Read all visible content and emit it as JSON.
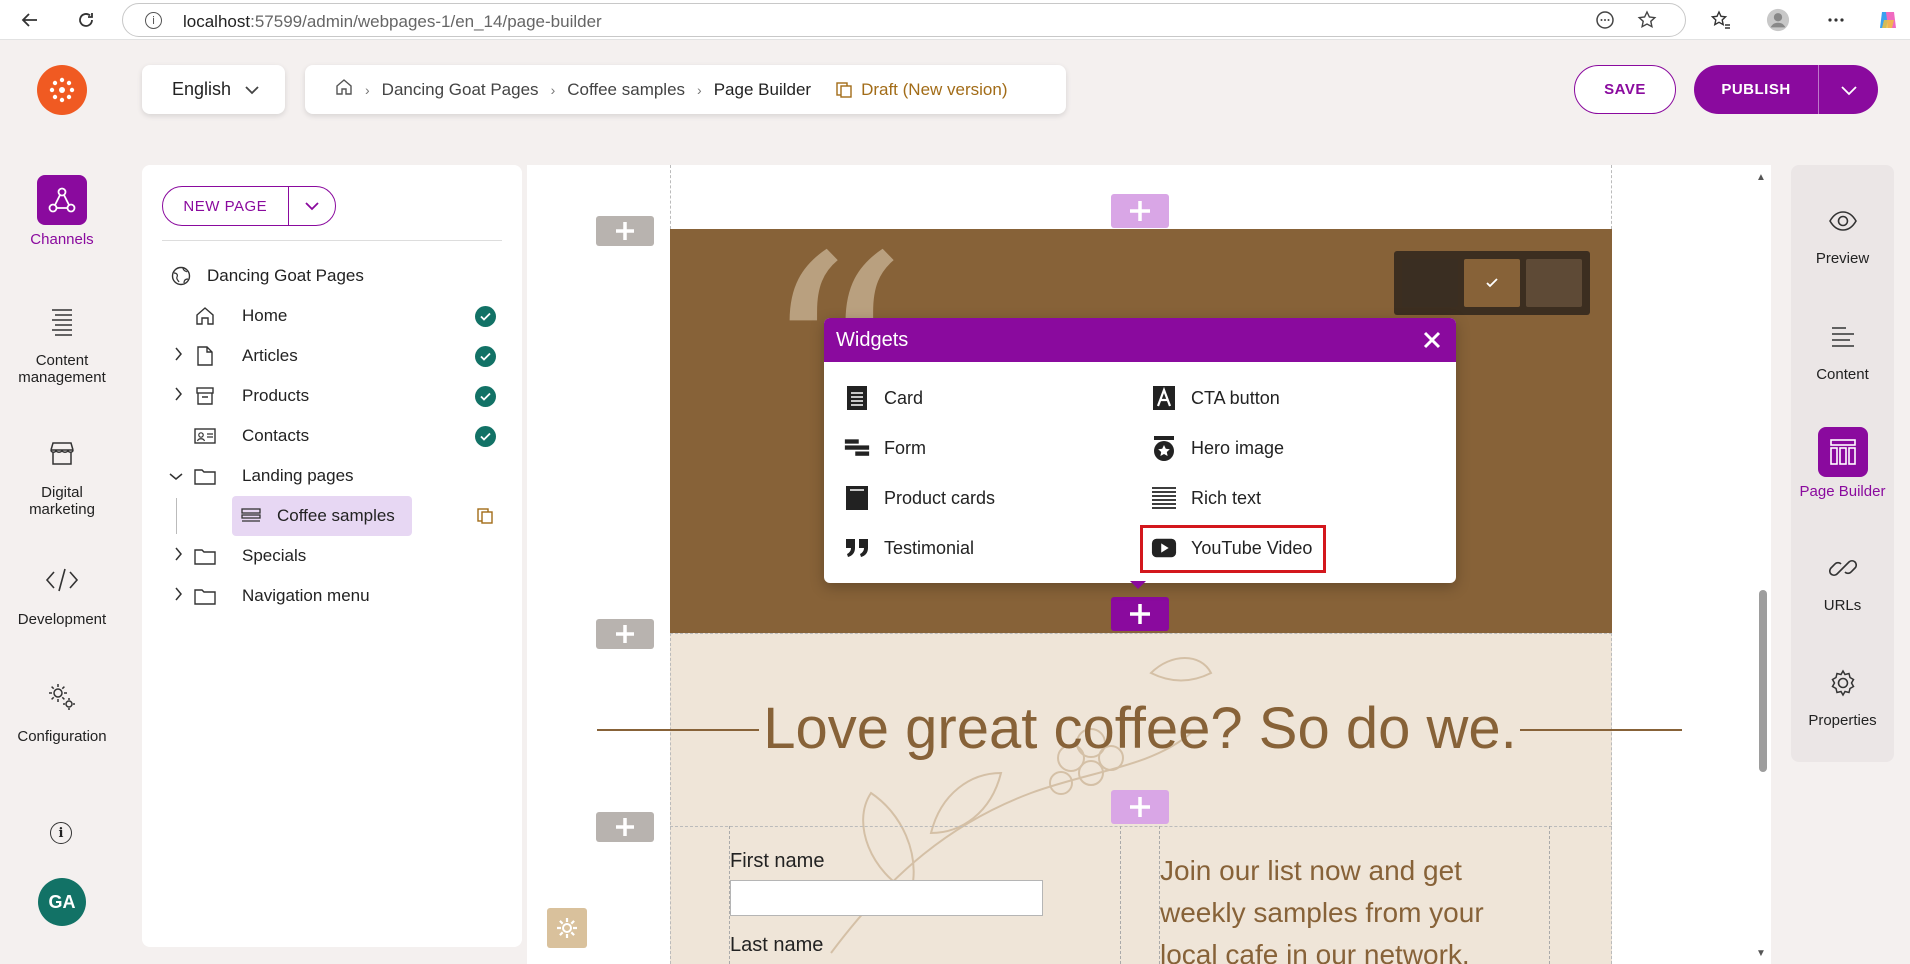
{
  "browser": {
    "url_host": "localhost",
    "url_rest": ":57599/admin/webpages-1/en_14/page-builder"
  },
  "header": {
    "language": "English",
    "breadcrumb": [
      "Dancing Goat Pages",
      "Coffee samples",
      "Page Builder"
    ],
    "status": "Draft (New version)",
    "save_label": "SAVE",
    "publish_label": "PUBLISH"
  },
  "left_nav": {
    "items": [
      {
        "label": "Channels",
        "icon": "channels-icon",
        "active": true
      },
      {
        "label": "Content management",
        "icon": "content-management-icon"
      },
      {
        "label": "Digital marketing",
        "icon": "store-icon"
      },
      {
        "label": "Development",
        "icon": "code-icon"
      },
      {
        "label": "Configuration",
        "icon": "gears-icon"
      }
    ],
    "avatar_initials": "GA"
  },
  "tree": {
    "new_page_label": "NEW PAGE",
    "root": "Dancing Goat Pages",
    "nodes": [
      {
        "label": "Home",
        "expandable": false,
        "published": true
      },
      {
        "label": "Articles",
        "expandable": true,
        "published": true
      },
      {
        "label": "Products",
        "expandable": true,
        "published": true
      },
      {
        "label": "Contacts",
        "expandable": false,
        "published": true
      },
      {
        "label": "Landing pages",
        "expandable": true,
        "expanded": true
      },
      {
        "label": "Coffee samples",
        "selected": true,
        "draft": true
      },
      {
        "label": "Specials",
        "expandable": true
      },
      {
        "label": "Navigation menu",
        "expandable": true
      }
    ]
  },
  "widgets_dialog": {
    "title": "Widgets",
    "items": [
      {
        "label": "Card",
        "icon": "card-icon"
      },
      {
        "label": "CTA button",
        "icon": "cta-button-icon"
      },
      {
        "label": "Form",
        "icon": "form-icon"
      },
      {
        "label": "Hero image",
        "icon": "hero-image-icon"
      },
      {
        "label": "Product cards",
        "icon": "product-cards-icon"
      },
      {
        "label": "Rich text",
        "icon": "rich-text-icon"
      },
      {
        "label": "Testimonial",
        "icon": "quote-icon"
      },
      {
        "label": "YouTube Video",
        "icon": "youtube-icon",
        "highlighted": true
      }
    ]
  },
  "canvas": {
    "heading": "Love great coffee? So do we.",
    "first_name_label": "First name",
    "last_name_label": "Last name",
    "join_text": "Join our list now and get weekly samples from your local cafe in our network.",
    "colors": {
      "brown": "#876238",
      "beige": "#efe5d8",
      "accent": "#8a0a9e"
    }
  },
  "right_panel": {
    "items": [
      {
        "label": "Preview",
        "icon": "eye-icon"
      },
      {
        "label": "Content",
        "icon": "content-lines-icon"
      },
      {
        "label": "Page Builder",
        "icon": "page-builder-icon",
        "active": true
      },
      {
        "label": "URLs",
        "icon": "link-icon"
      },
      {
        "label": "Properties",
        "icon": "gear-icon"
      }
    ]
  }
}
